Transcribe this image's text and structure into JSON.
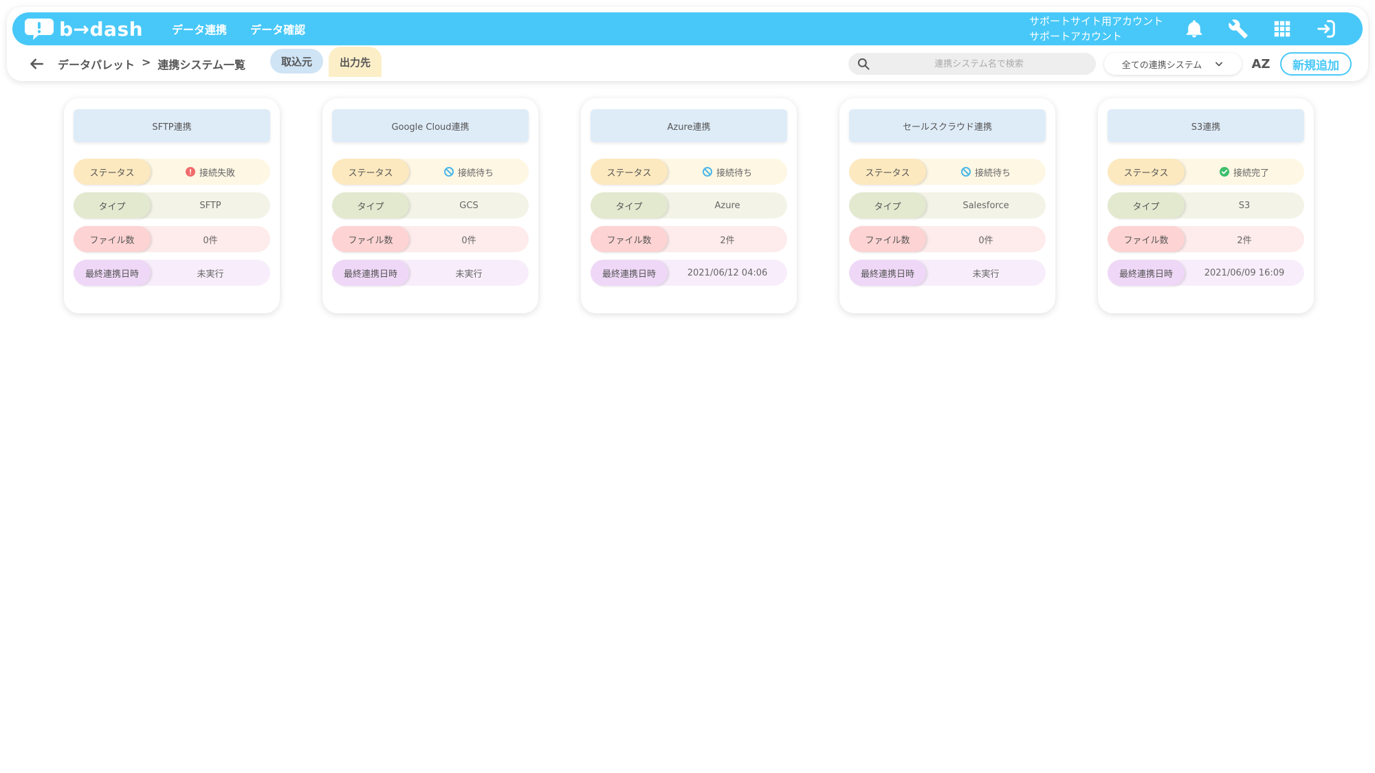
{
  "header": {
    "logo_text": "b→dash",
    "nav": [
      {
        "label": "データ連携"
      },
      {
        "label": "データ確認"
      }
    ],
    "account_line1": "サポートサイト用アカウント",
    "account_line2": "サポートアカウント",
    "icons": [
      "bell-icon",
      "wrench-icon",
      "grid-icon",
      "logout-icon"
    ]
  },
  "subbar": {
    "breadcrumb": [
      "データパレット",
      ">",
      "連携システム一覧"
    ],
    "tabs": [
      {
        "label": "取込元"
      },
      {
        "label": "出力先"
      }
    ],
    "search_placeholder": "連携システム名で検索",
    "filter_value": "全ての連携システム",
    "sort_label": "AZ",
    "add_label": "新規追加"
  },
  "labels": {
    "status": "ステータス",
    "type": "タイプ",
    "files": "ファイル数",
    "last": "最終連携日時"
  },
  "status_colors": {
    "failed": "#f26b6b",
    "waiting": "#48b6e8",
    "done": "#3bbf6a"
  },
  "cards": [
    {
      "title": "SFTP連携",
      "status": "接続失敗",
      "status_kind": "failed",
      "type": "SFTP",
      "files": "0件",
      "last": "未実行"
    },
    {
      "title": "Google Cloud連携",
      "status": "接続待ち",
      "status_kind": "waiting",
      "type": "GCS",
      "files": "0件",
      "last": "未実行"
    },
    {
      "title": "Azure連携",
      "status": "接続待ち",
      "status_kind": "waiting",
      "type": "Azure",
      "files": "2件",
      "last": "2021/06/12 04:06"
    },
    {
      "title": "セールスクラウド連携",
      "status": "接続待ち",
      "status_kind": "waiting",
      "type": "Salesforce",
      "files": "0件",
      "last": "未実行"
    },
    {
      "title": "S3連携",
      "status": "接続完了",
      "status_kind": "done",
      "type": "S3",
      "files": "2件",
      "last": "2021/06/09 16:09"
    }
  ]
}
